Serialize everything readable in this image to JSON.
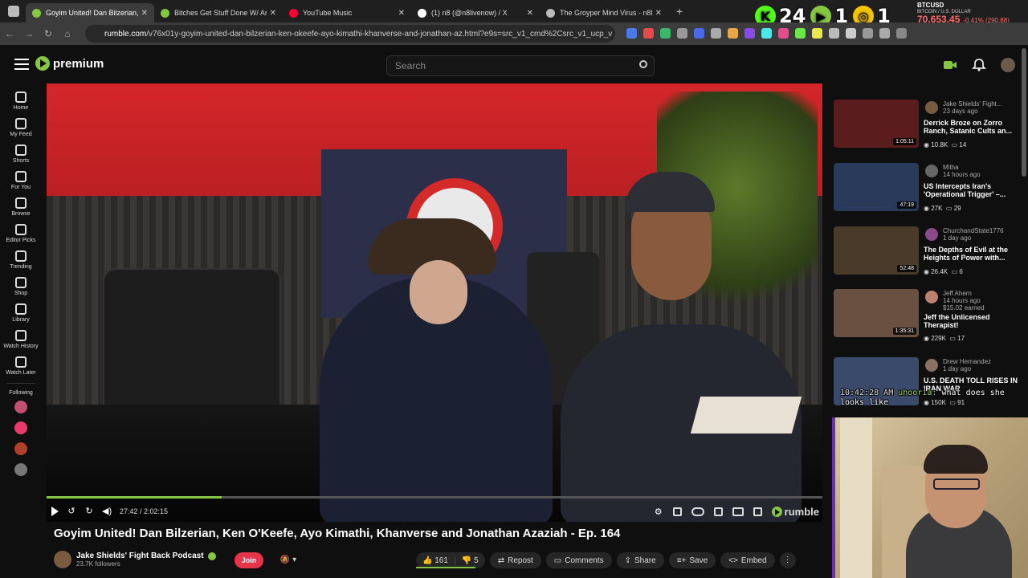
{
  "browser": {
    "tabs": [
      {
        "title": "Goyim United! Dan Bilzerian, K",
        "active": true,
        "favicon_color": "#85c742"
      },
      {
        "title": "Bitches Get Stuff Done W/ Aryn",
        "active": false,
        "favicon_color": "#85c742"
      },
      {
        "title": "YouTube Music",
        "active": false,
        "favicon_color": "#ff0033"
      },
      {
        "title": "(1) n8 (@n8livenow) / X",
        "active": false,
        "favicon_color": "#ffffff"
      },
      {
        "title": "The Groyper Mind Virus - n8liv",
        "active": false,
        "favicon_color": "#bbbbbb"
      }
    ],
    "url_host": "rumble.com",
    "url_path": "/v76x01y-goyim-united-dan-bilzerian-ken-okeefe-ayo-kimathi-khanverse-and-jonathan-az.html?e9s=src_v1_cmd%2Csrc_v1_ucp_v"
  },
  "overlay": {
    "stat1": "24",
    "stat2": "1",
    "stat3": "1",
    "btc_label": "BTCUSD",
    "btc_sub": "BITCOIN / U.S. DOLLAR",
    "btc_price": "70,653.45",
    "btc_change": "-0.41% (290.88)"
  },
  "header": {
    "logo_text": "premium",
    "search_placeholder": "Search"
  },
  "sidebar": {
    "items": [
      {
        "label": "Home"
      },
      {
        "label": "My Feed"
      },
      {
        "label": "Shorts"
      },
      {
        "label": "For You"
      },
      {
        "label": "Browse"
      },
      {
        "label": "Editor Picks"
      },
      {
        "label": "Trending"
      },
      {
        "label": "Shop"
      },
      {
        "label": "Library"
      },
      {
        "label": "Watch History"
      },
      {
        "label": "Watch Later"
      }
    ],
    "following_label": "Following"
  },
  "player": {
    "time": "27:42 / 2:02:15",
    "progress": 0.226,
    "brand": "rumble"
  },
  "video": {
    "title": "Goyim United! Dan Bilzerian, Ken O'Keefe, Ayo Kimathi, Khanverse and Jonathan Azaziah - Ep. 164",
    "channel": "Jake Shields' Fight Back Podcast",
    "followers": "23.7K followers",
    "join_label": "Join",
    "likes": "161",
    "dislikes": "5",
    "repost_label": "Repost",
    "comments_label": "Comments",
    "share_label": "Share",
    "save_label": "Save",
    "embed_label": "Embed"
  },
  "recommendations": [
    {
      "channel": "Jake Shields' Fight...",
      "ago": "23 days ago",
      "title": "Derrick Broze on Zorro Ranch, Satanic Cults an...",
      "views": "10.8K",
      "comments": "14",
      "duration": "1:05:11",
      "thumb_color": "#5a1c1c",
      "avatar_color": "#7a5b3f"
    },
    {
      "channel": "Mitha",
      "ago": "14 hours ago",
      "title": "US Intercepts Iran's 'Operational Trigger' –...",
      "views": "27K",
      "comments": "29",
      "duration": "47:19",
      "thumb_color": "#2a3a5a",
      "avatar_color": "#666666"
    },
    {
      "channel": "ChurchandState1776",
      "ago": "1 day ago",
      "title": "The Depths of Evil at the Heights of Power with...",
      "views": "26.4K",
      "comments": "6",
      "duration": "52:48",
      "thumb_color": "#4a3a2a",
      "avatar_color": "#8a4a8a"
    },
    {
      "channel": "Jeff Ahern",
      "ago": "14 hours ago",
      "earned": "$15.02 earned",
      "title": "Jeff the Unlicensed Therapist!",
      "views": "229K",
      "comments": "17",
      "duration": "1:35:31",
      "thumb_color": "#6a5040",
      "avatar_color": "#c08070"
    },
    {
      "channel": "Drew Hernandez",
      "ago": "1 day ago",
      "title": "U.S. DEATH TOLL RISES IN IRAN WAR",
      "views": "150K",
      "comments": "91",
      "duration": "",
      "thumb_color": "#3a4a6a",
      "avatar_color": "#8a7060"
    }
  ],
  "webcam_caption": {
    "timestamp": "10:42:28 AM",
    "user": "uhooria:",
    "text": "what does she looks like"
  }
}
